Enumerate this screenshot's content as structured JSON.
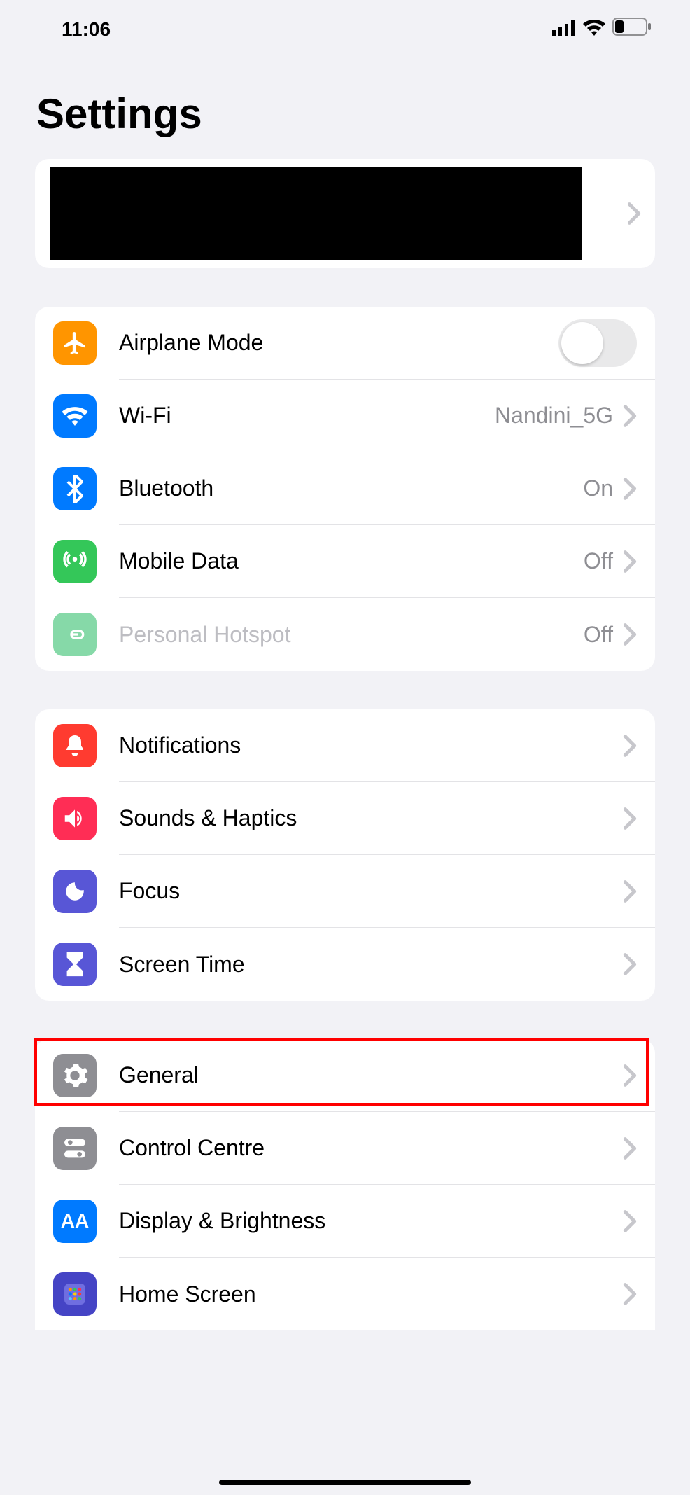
{
  "status": {
    "time": "11:06"
  },
  "title": "Settings",
  "groups": [
    {
      "rows": [
        {
          "key": "airplane",
          "label": "Airplane Mode",
          "value": "",
          "toggle": true,
          "disabled": false,
          "icon": "airplane-icon"
        },
        {
          "key": "wifi",
          "label": "Wi-Fi",
          "value": "Nandini_5G",
          "toggle": false,
          "disabled": false,
          "icon": "wifi-icon"
        },
        {
          "key": "bluetooth",
          "label": "Bluetooth",
          "value": "On",
          "toggle": false,
          "disabled": false,
          "icon": "bluetooth-icon"
        },
        {
          "key": "mobile",
          "label": "Mobile Data",
          "value": "Off",
          "toggle": false,
          "disabled": false,
          "icon": "antenna-icon"
        },
        {
          "key": "hotspot",
          "label": "Personal Hotspot",
          "value": "Off",
          "toggle": false,
          "disabled": true,
          "icon": "link-icon"
        }
      ]
    },
    {
      "rows": [
        {
          "key": "notif",
          "label": "Notifications",
          "icon": "bell-icon"
        },
        {
          "key": "sounds",
          "label": "Sounds & Haptics",
          "icon": "speaker-icon"
        },
        {
          "key": "focus",
          "label": "Focus",
          "icon": "moon-icon"
        },
        {
          "key": "screen",
          "label": "Screen Time",
          "icon": "hourglass-icon"
        }
      ]
    },
    {
      "rows": [
        {
          "key": "general",
          "label": "General",
          "icon": "gear-icon"
        },
        {
          "key": "control",
          "label": "Control Centre",
          "icon": "switches-icon"
        },
        {
          "key": "display",
          "label": "Display & Brightness",
          "icon": "aa-icon"
        },
        {
          "key": "home",
          "label": "Home Screen",
          "icon": "grid-icon"
        }
      ]
    }
  ]
}
